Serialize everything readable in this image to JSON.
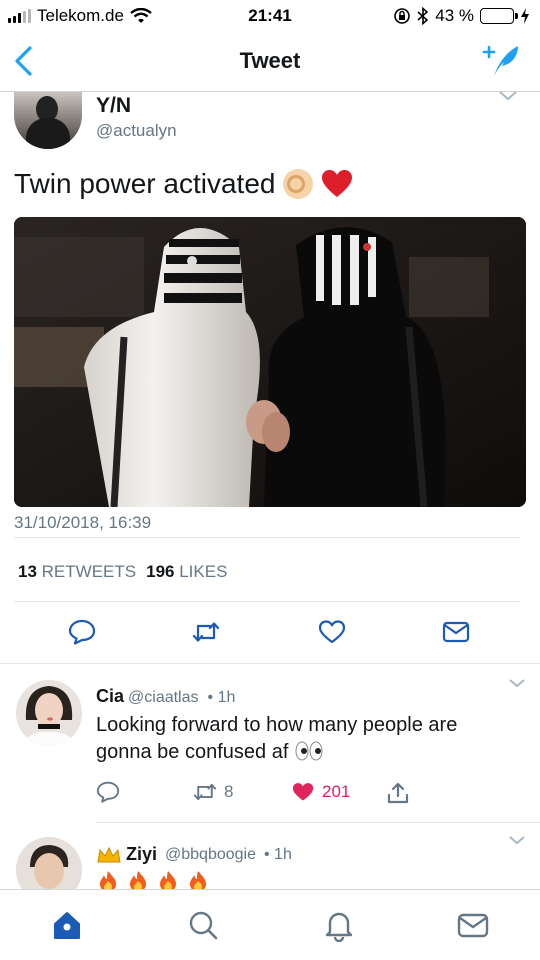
{
  "status_bar": {
    "carrier": "Telekom.de",
    "time": "21:41",
    "battery_percent": "43 %",
    "battery_level": 0.43,
    "icons": [
      "signal-icon",
      "wifi-icon",
      "orientation-lock-icon",
      "bluetooth-icon",
      "battery-icon",
      "charging-icon"
    ]
  },
  "nav": {
    "title": "Tweet",
    "icons": [
      "back-chevron-icon",
      "compose-tweet-icon"
    ]
  },
  "tweet": {
    "display_name": "Y/N",
    "handle": "@actualyn",
    "text": "Twin power activated",
    "emojis": [
      "ok-hand-emoji",
      "red-heart-emoji"
    ],
    "timestamp": "31/10/2018, 16:39",
    "retweets_count": "13",
    "retweets_label": "RETWEETS",
    "likes_count": "196",
    "likes_label": "LIKES",
    "action_icons": [
      "reply-icon",
      "retweet-icon",
      "like-icon",
      "direct-message-icon"
    ]
  },
  "replies": [
    {
      "name": "Cia",
      "handle": "@ciaatlas",
      "age": "• 1h",
      "text": "Looking forward to how many people are gonna be confused af",
      "emoji": "eyes-emoji",
      "retweets": "8",
      "likes": "201",
      "liked": true
    },
    {
      "name": "Ziyi",
      "handle": "@bbqboogie",
      "age": "• 1h",
      "name_emoji": "crown-emoji",
      "text_emojis": [
        "fire-emoji",
        "fire-emoji",
        "fire-emoji",
        "fire-emoji"
      ]
    }
  ],
  "tab_bar": {
    "tabs": [
      "home-icon",
      "search-icon",
      "notifications-icon",
      "messages-icon"
    ],
    "active": "home-icon"
  },
  "colors": {
    "accent": "#1da1f2",
    "like": "#e0245e",
    "muted": "#657786",
    "text": "#14171a",
    "tab_active": "#1c5bb5"
  }
}
